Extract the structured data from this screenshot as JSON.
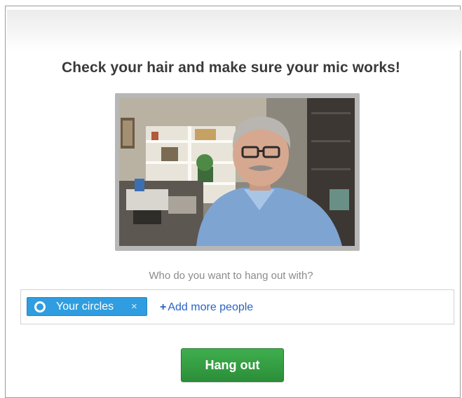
{
  "title": "Check your hair and make sure your mic works!",
  "video": {
    "description_icon": "webcam-preview"
  },
  "invite": {
    "prompt": "Who do you want to hang out with?",
    "chip_label": "Your circles",
    "chip_remove": "×",
    "add_label": "Add more people",
    "add_plus": "+"
  },
  "actions": {
    "hangout_label": "Hang out"
  },
  "colors": {
    "chip": "#2f9de0",
    "link": "#2a63c4",
    "button": "#2b8f39",
    "title": "#3a3a3a"
  }
}
